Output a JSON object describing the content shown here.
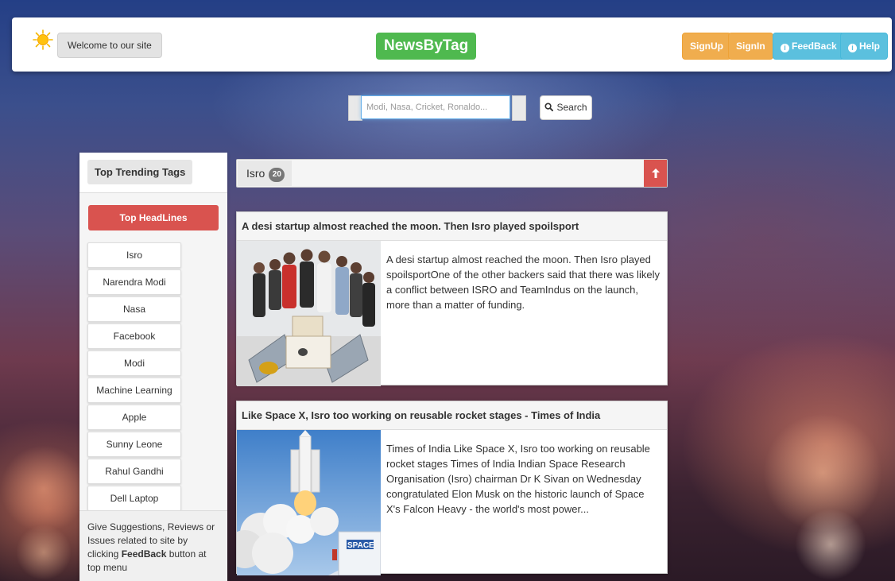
{
  "header": {
    "welcome": "Welcome to our site",
    "brand": "NewsByTag",
    "signup": "SignUp",
    "signin": "SignIn",
    "feedback": "FeedBack",
    "help": "Help"
  },
  "search": {
    "placeholder": "Modi, Nasa, Cricket, Ronaldo...",
    "button": "Search"
  },
  "sidebar": {
    "title": "Top Trending Tags",
    "headlines": "Top HeadLines",
    "tags": [
      "Isro",
      "Narendra Modi",
      "Nasa",
      "Facebook",
      "Modi",
      "Machine Learning",
      "Apple",
      "Sunny Leone",
      "Rahul Gandhi",
      "Dell Laptop"
    ],
    "footer_text": "Give Suggestions, Reviews or Issues related to site by clicking",
    "footer_bold": "FeedBack",
    "footer_end": "button at top menu"
  },
  "main": {
    "tag": "Isro",
    "count": "20",
    "articles": [
      {
        "title": "A desi startup almost reached the moon. Then Isro played spoilsport",
        "text": "A desi startup almost reached the moon. Then Isro played spoilsportOne of the other backers said that there was likely a conflict between ISRO and TeamIndus on the launch, more than a matter of funding."
      },
      {
        "title": "Like Space X, Isro too working on reusable rocket stages - Times of India",
        "text": "Times of India Like Space X, Isro too working on reusable rocket stages Times of India Indian Space Research Organisation (Isro) chairman Dr K Sivan on Wednesday congratulated Elon Musk on the historic launch of Space X's Falcon Heavy - the world's most power..."
      }
    ]
  },
  "colors": {
    "brand": "#4fb94f",
    "orange": "#f0ad4e",
    "info": "#5bc0de",
    "danger": "#d9534f"
  }
}
